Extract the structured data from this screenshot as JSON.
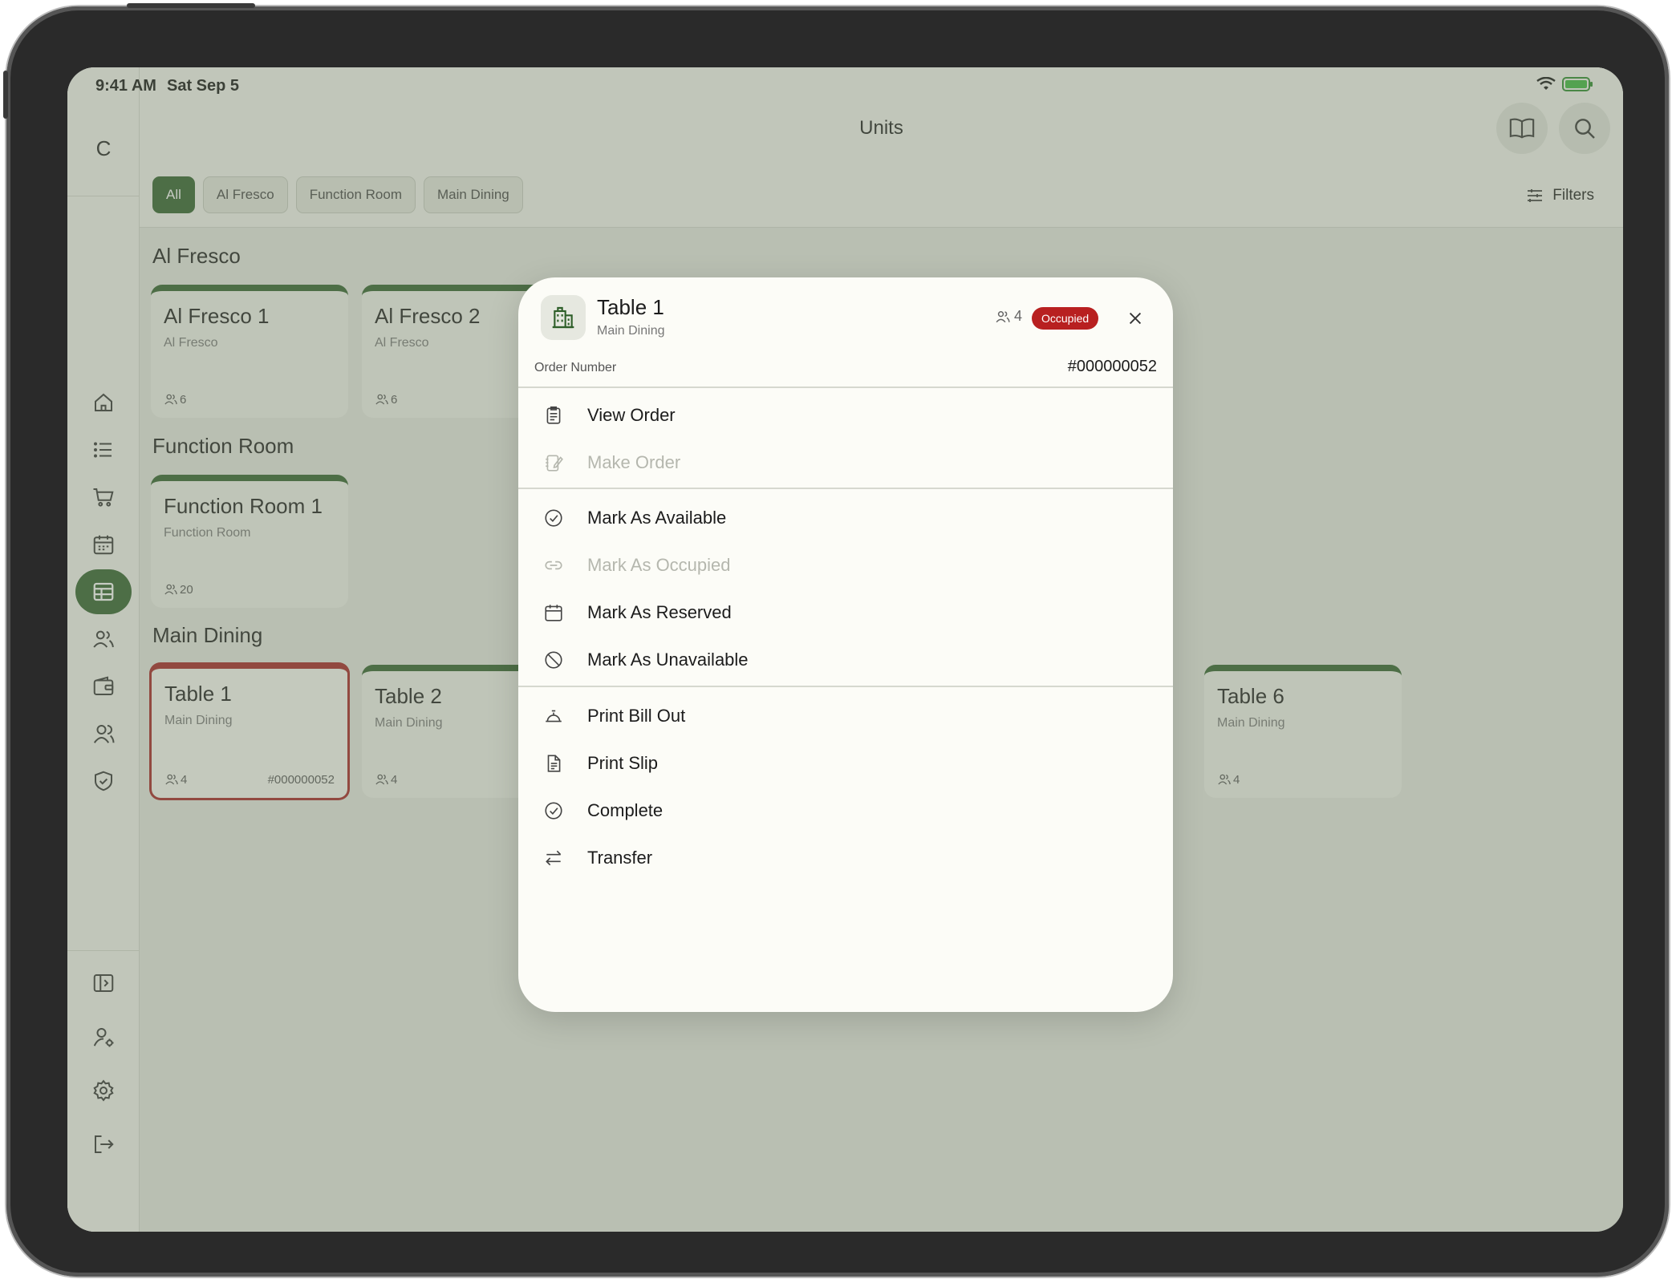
{
  "status_bar": {
    "time": "9:41 AM",
    "date": "Sat Sep 5"
  },
  "app": {
    "logo": "C",
    "title": "Units"
  },
  "header": {
    "filters_label": "Filters",
    "chips": [
      "All",
      "Al Fresco",
      "Function Room",
      "Main Dining"
    ]
  },
  "sections": {
    "al_fresco": {
      "title": "Al Fresco",
      "cards": [
        {
          "name": "Al Fresco 1",
          "area": "Al Fresco",
          "capacity": "6"
        },
        {
          "name": "Al Fresco 2",
          "area": "Al Fresco",
          "capacity": "6"
        }
      ]
    },
    "function_room": {
      "title": "Function Room",
      "cards": [
        {
          "name": "Function Room 1",
          "area": "Function Room",
          "capacity": "20"
        }
      ]
    },
    "main_dining": {
      "title": "Main Dining",
      "cards": [
        {
          "name": "Table 1",
          "area": "Main Dining",
          "capacity": "4",
          "order": "#000000052"
        },
        {
          "name": "Table 2",
          "area": "Main Dining",
          "capacity": "4"
        },
        {
          "name": "Table 6",
          "area": "Main Dining",
          "capacity": "4"
        }
      ]
    }
  },
  "modal": {
    "title": "Table 1",
    "subtitle": "Main Dining",
    "capacity": "4",
    "status": "Occupied",
    "order_label": "Order Number",
    "order_number": "#000000052",
    "actions": [
      {
        "label": "View Order",
        "icon": "clipboard-icon",
        "enabled": true
      },
      {
        "label": "Make Order",
        "icon": "edit-note-icon",
        "enabled": false
      },
      {
        "label": "Mark As Available",
        "icon": "check-circle-icon",
        "enabled": true
      },
      {
        "label": "Mark As Occupied",
        "icon": "link-icon",
        "enabled": false
      },
      {
        "label": "Mark As Reserved",
        "icon": "calendar-icon",
        "enabled": true
      },
      {
        "label": "Mark As Unavailable",
        "icon": "ban-icon",
        "enabled": true
      },
      {
        "label": "Print Bill Out",
        "icon": "bell-icon",
        "enabled": true
      },
      {
        "label": "Print Slip",
        "icon": "document-icon",
        "enabled": true
      },
      {
        "label": "Complete",
        "icon": "check-circle-icon",
        "enabled": true
      },
      {
        "label": "Transfer",
        "icon": "transfer-icon",
        "enabled": true
      }
    ]
  },
  "colors": {
    "brand": "#2f5f2a",
    "occupied": "#b82020",
    "disabled": "#b5b7ae"
  }
}
